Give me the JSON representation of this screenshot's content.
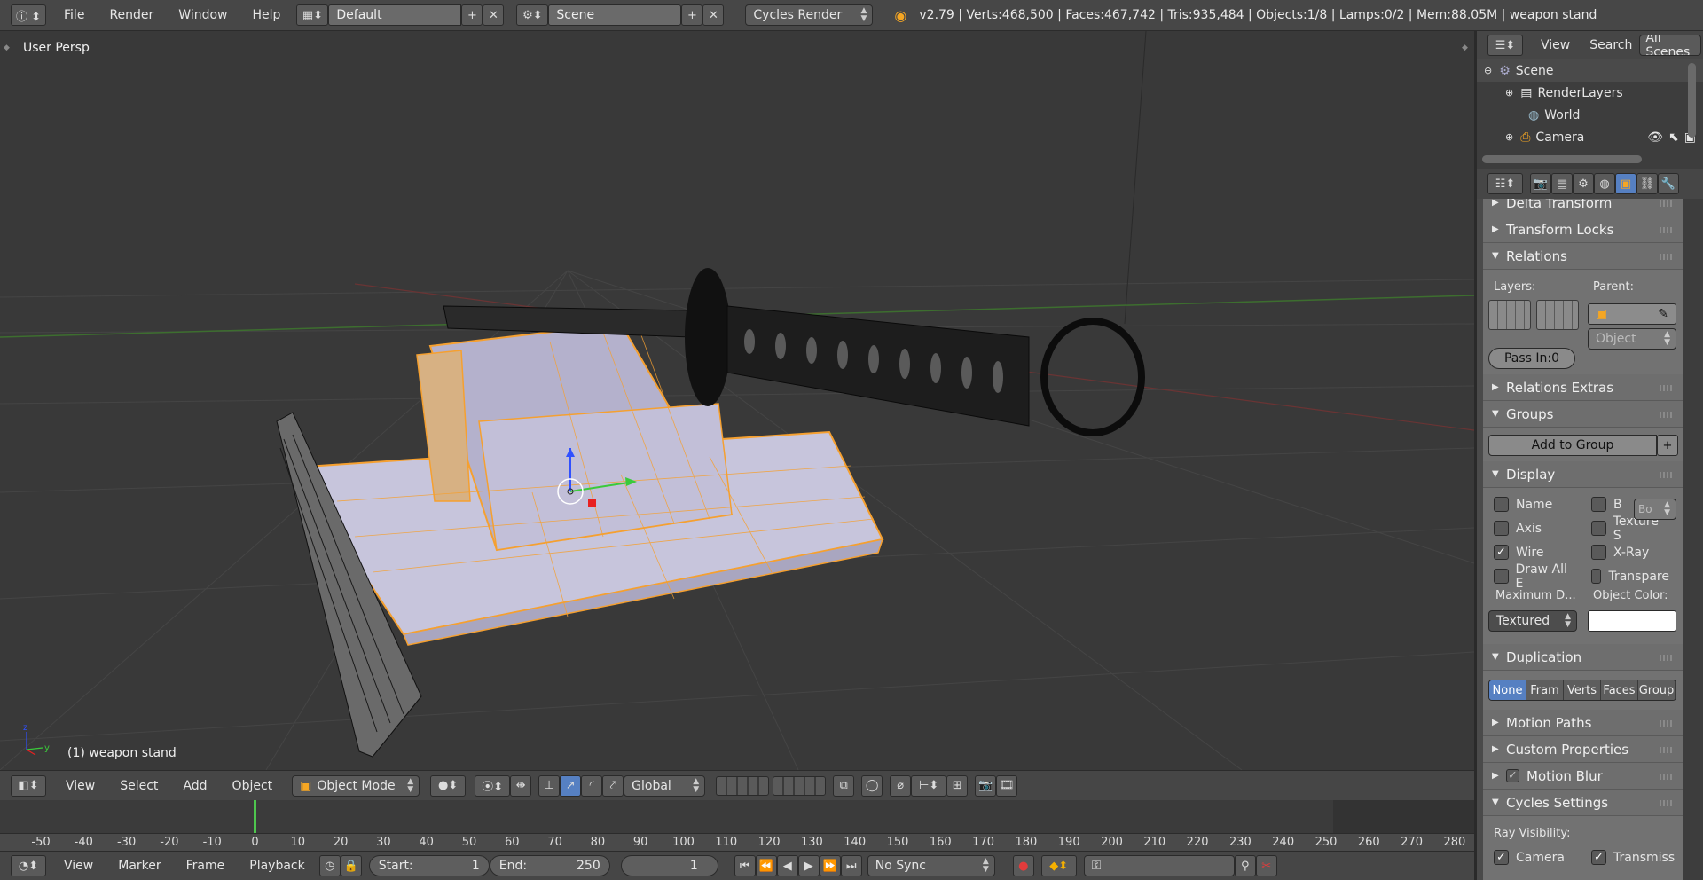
{
  "topbar": {
    "menus": [
      "File",
      "Render",
      "Window",
      "Help"
    ],
    "layout": "Default",
    "scene": "Scene",
    "engine": "Cycles Render",
    "stats": "v2.79 | Verts:468,500 | Faces:467,742 | Tris:935,484 | Objects:1/8 | Lamps:0/2 | Mem:88.05M | weapon stand"
  },
  "viewport": {
    "label": "User Persp",
    "object_label": "(1) weapon stand"
  },
  "view3d_header": {
    "menus": [
      "View",
      "Select",
      "Add",
      "Object"
    ],
    "mode": "Object Mode",
    "orientation": "Global"
  },
  "outliner": {
    "menus": [
      "View",
      "Search"
    ],
    "filter": "All Scenes",
    "items": [
      "Scene",
      "RenderLayers",
      "World",
      "Camera"
    ]
  },
  "properties": {
    "panels": {
      "delta_transform": "Delta Transform",
      "transform_locks": "Transform Locks",
      "relations": "Relations",
      "relations_extras": "Relations Extras",
      "groups": "Groups",
      "display": "Display",
      "duplication": "Duplication",
      "motion_paths": "Motion Paths",
      "custom_properties": "Custom Properties",
      "motion_blur": "Motion Blur",
      "cycles_settings": "Cycles Settings"
    },
    "relations": {
      "layers_label": "Layers:",
      "parent_label": "Parent:",
      "parent_type": "Object",
      "pass_index": "Pass In:0"
    },
    "groups": {
      "add_button": "Add to Group"
    },
    "display": {
      "options": [
        {
          "label": "Name",
          "checked": false
        },
        {
          "label": "B",
          "checked": false
        },
        {
          "label": "Axis",
          "checked": false
        },
        {
          "label": "Texture S",
          "checked": false
        },
        {
          "label": "Wire",
          "checked": true
        },
        {
          "label": "X-Ray",
          "checked": false
        },
        {
          "label": "Draw All E",
          "checked": false
        },
        {
          "label": "Transpare",
          "checked": false
        }
      ],
      "bounds_field": "Bo",
      "max_draw_label": "Maximum D...",
      "max_draw_value": "Textured",
      "object_color_label": "Object Color:"
    },
    "duplication": {
      "options": [
        "None",
        "Fram",
        "Verts",
        "Faces",
        "Group"
      ],
      "selected": "None"
    },
    "cycles": {
      "ray_visibility": "Ray Visibility:",
      "camera": "Camera",
      "transmission": "Transmiss"
    }
  },
  "timeline": {
    "ticks": [
      "-50",
      "-40",
      "-30",
      "-20",
      "-10",
      "0",
      "10",
      "20",
      "30",
      "40",
      "50",
      "60",
      "70",
      "80",
      "90",
      "100",
      "110",
      "120",
      "130",
      "140",
      "150",
      "160",
      "170",
      "180",
      "190",
      "200",
      "210",
      "220",
      "230",
      "240",
      "250",
      "260",
      "270",
      "280"
    ],
    "current_frame": 1,
    "menus": [
      "View",
      "Marker",
      "Frame",
      "Playback"
    ],
    "start_label": "Start:",
    "start": "1",
    "end_label": "End:",
    "end": "250",
    "frame": "1",
    "sync": "No Sync"
  }
}
